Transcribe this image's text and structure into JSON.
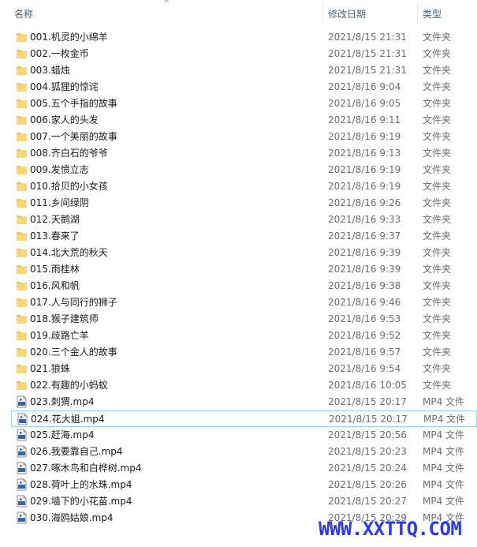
{
  "header": {
    "name_label": "名称",
    "date_label": "修改日期",
    "type_label": "类型",
    "sort_indicator": "^"
  },
  "icons": {
    "folder": "folder-icon",
    "video": "mp4-file-icon",
    "folder_color": "#f3c458",
    "video_badge_color": "#2f66b3"
  },
  "rows": [
    {
      "name": "001.机灵的小绵羊",
      "date": "2021/8/15 21:31",
      "type": "文件夹",
      "kind": "folder"
    },
    {
      "name": "002.一枚金币",
      "date": "2021/8/15 21:31",
      "type": "文件夹",
      "kind": "folder"
    },
    {
      "name": "003.蜡烛",
      "date": "2021/8/15 21:31",
      "type": "文件夹",
      "kind": "folder"
    },
    {
      "name": "004.狐狸的惊诧",
      "date": "2021/8/16 9:04",
      "type": "文件夹",
      "kind": "folder"
    },
    {
      "name": "005.五个手指的故事",
      "date": "2021/8/16 9:05",
      "type": "文件夹",
      "kind": "folder"
    },
    {
      "name": "006.家人的头发",
      "date": "2021/8/16 9:11",
      "type": "文件夹",
      "kind": "folder"
    },
    {
      "name": "007.一个美丽的故事",
      "date": "2021/8/16 9:19",
      "type": "文件夹",
      "kind": "folder"
    },
    {
      "name": "008.齐白石的爷爷",
      "date": "2021/8/16 9:13",
      "type": "文件夹",
      "kind": "folder"
    },
    {
      "name": "009.发愤立志",
      "date": "2021/8/16 9:19",
      "type": "文件夹",
      "kind": "folder"
    },
    {
      "name": "010.拾贝的小女孩",
      "date": "2021/8/16 9:19",
      "type": "文件夹",
      "kind": "folder"
    },
    {
      "name": "011.乡间绿阴",
      "date": "2021/8/16 9:26",
      "type": "文件夹",
      "kind": "folder"
    },
    {
      "name": "012.天鹅湖",
      "date": "2021/8/16 9:33",
      "type": "文件夹",
      "kind": "folder"
    },
    {
      "name": "013.春来了",
      "date": "2021/8/16 9:37",
      "type": "文件夹",
      "kind": "folder"
    },
    {
      "name": "014.北大荒的秋天",
      "date": "2021/8/16 9:39",
      "type": "文件夹",
      "kind": "folder"
    },
    {
      "name": "015.雨桂林",
      "date": "2021/8/16 9:39",
      "type": "文件夹",
      "kind": "folder"
    },
    {
      "name": "016.风和帆",
      "date": "2021/8/16 9:38",
      "type": "文件夹",
      "kind": "folder"
    },
    {
      "name": "017.人与同行的狮子",
      "date": "2021/8/16 9:46",
      "type": "文件夹",
      "kind": "folder"
    },
    {
      "name": "018.猴子建筑师",
      "date": "2021/8/16 9:53",
      "type": "文件夹",
      "kind": "folder"
    },
    {
      "name": "019.歧路亡羊",
      "date": "2021/8/16 9:52",
      "type": "文件夹",
      "kind": "folder"
    },
    {
      "name": "020.三个金人的故事",
      "date": "2021/8/16 9:57",
      "type": "文件夹",
      "kind": "folder"
    },
    {
      "name": "021.狼蛛",
      "date": "2021/8/16 9:54",
      "type": "文件夹",
      "kind": "folder"
    },
    {
      "name": "022.有趣的小蚂蚁",
      "date": "2021/8/16 10:05",
      "type": "文件夹",
      "kind": "folder"
    },
    {
      "name": "023.刺猬.mp4",
      "date": "2021/8/15 20:17",
      "type": "MP4 文件",
      "kind": "video"
    },
    {
      "name": "024.花大姐.mp4",
      "date": "2021/8/15 20:17",
      "type": "MP4 文件",
      "kind": "video",
      "selected": true
    },
    {
      "name": "025.赶海.mp4",
      "date": "2021/8/15 20:56",
      "type": "MP4 文件",
      "kind": "video"
    },
    {
      "name": "026.我要靠自己.mp4",
      "date": "2021/8/15 20:23",
      "type": "MP4 文件",
      "kind": "video"
    },
    {
      "name": "027.啄木鸟和白桦树.mp4",
      "date": "2021/8/15 20:24",
      "type": "MP4 文件",
      "kind": "video"
    },
    {
      "name": "028.荷叶上的水珠.mp4",
      "date": "2021/8/15 20:26",
      "type": "MP4 文件",
      "kind": "video"
    },
    {
      "name": "029.墙下的小花苗.mp4",
      "date": "2021/8/15 20:27",
      "type": "MP4 文件",
      "kind": "video"
    },
    {
      "name": "030.海鸥姑娘.mp4",
      "date": "2021/8/15 20:29",
      "type": "MP4 文件",
      "kind": "video"
    }
  ],
  "watermark": "WWW.XXTTQ.COM"
}
